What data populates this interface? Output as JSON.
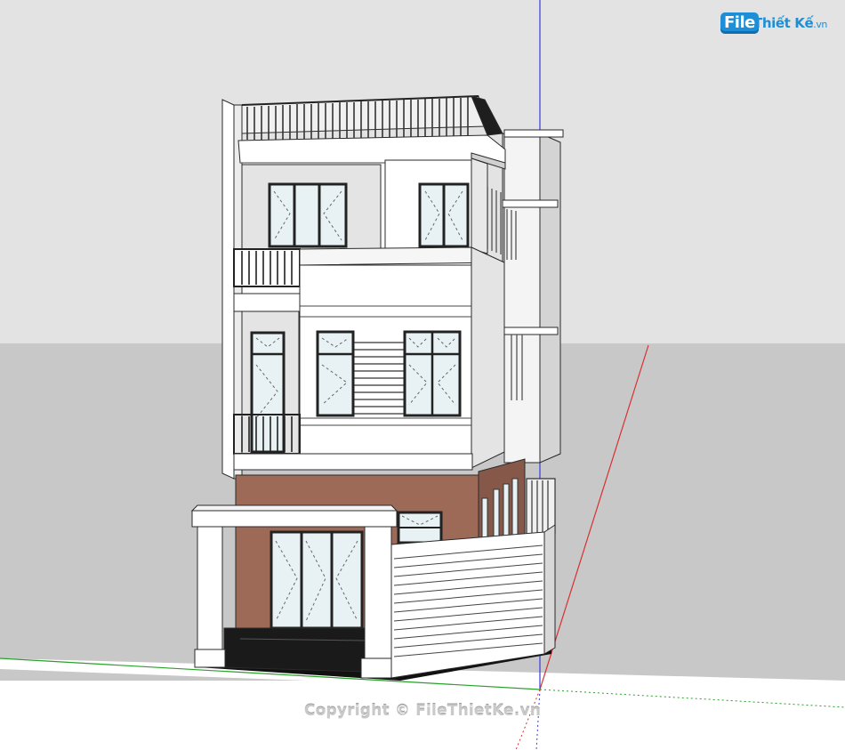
{
  "app": {
    "logo": {
      "file": "File",
      "rest": "Thiết Kế",
      "tld": ".vn"
    },
    "watermark": "Copyright © FileThietKe.vn"
  },
  "scene": {
    "sky_color": "#e3e3e3",
    "ground_color": "#c8c8c8",
    "wall_color": "#ffffff",
    "shadow_wall_color": "#dcdcdc",
    "brick_color": "#9e6a58",
    "glass_color": "#e8f2f4",
    "frame_color": "#2a2a2a",
    "axis_colors": {
      "blue": "#3a3ae0",
      "red": "#d83030",
      "green": "#2aa02a"
    }
  }
}
